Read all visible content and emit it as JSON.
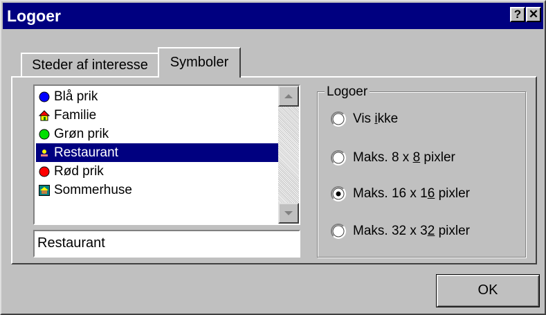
{
  "window": {
    "title": "Logoer",
    "help_button": "?",
    "close_button": "✕"
  },
  "tabs": [
    {
      "label": "Steder af interesse",
      "active": false
    },
    {
      "label": "Symboler",
      "active": true
    }
  ],
  "symbol_list": {
    "items": [
      {
        "label": "Blå prik",
        "icon": "blue-dot-icon",
        "color": "#0000ff"
      },
      {
        "label": "Familie",
        "icon": "house-icon",
        "color": "#ff0000"
      },
      {
        "label": "Grøn prik",
        "icon": "green-dot-icon",
        "color": "#00c000"
      },
      {
        "label": "Restaurant",
        "icon": "restaurant-icon",
        "color": "#c0c0c0"
      },
      {
        "label": "Rød prik",
        "icon": "red-dot-icon",
        "color": "#ff0000"
      },
      {
        "label": "Sommerhuse",
        "icon": "cabin-icon",
        "color": "#008080"
      }
    ],
    "selected_index": 3
  },
  "selected_symbol": "Restaurant",
  "logo_group": {
    "title": "Logoer",
    "options": [
      {
        "label_pre": "Vis ",
        "label_ul": "i",
        "label_post": "kke",
        "checked": false
      },
      {
        "label_pre": "Maks. 8 x ",
        "label_ul": "8",
        "label_post": " pixler",
        "checked": false
      },
      {
        "label_pre": "Maks. 16 x 1",
        "label_ul": "6",
        "label_post": " pixler",
        "checked": true
      },
      {
        "label_pre": "Maks. 32 x 3",
        "label_ul": "2",
        "label_post": " pixler",
        "checked": false
      }
    ]
  },
  "ok_button": "OK",
  "colors": {
    "title_bar": "#000080",
    "selection": "#000080",
    "face": "#c0c0c0"
  }
}
